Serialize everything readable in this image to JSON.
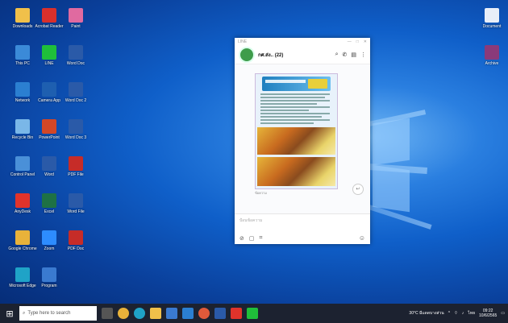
{
  "desktop": {
    "left_icons": [
      {
        "name": "folder-icon",
        "label": "Downloads",
        "color": "#f0c04a"
      },
      {
        "name": "pdf-icon",
        "label": "Acrobat Reader",
        "color": "#d9302c"
      },
      {
        "name": "paint-icon",
        "label": "Paint",
        "color": "#e06aa0"
      },
      {
        "name": "computer-icon",
        "label": "This PC",
        "color": "#3b8ad8"
      },
      {
        "name": "line-icon",
        "label": "LINE",
        "color": "#1fbf3a"
      },
      {
        "name": "word-icon",
        "label": "Word Doc",
        "color": "#2a5aa8"
      },
      {
        "name": "network-icon",
        "label": "Network",
        "color": "#2b7fd1"
      },
      {
        "name": "camera-icon",
        "label": "Camera App",
        "color": "#1e5fb0"
      },
      {
        "name": "word-icon",
        "label": "Word Doc 2",
        "color": "#2a5aa8"
      },
      {
        "name": "recycle-bin-icon",
        "label": "Recycle Bin",
        "color": "#7ab7e8"
      },
      {
        "name": "powerpoint-icon",
        "label": "PowerPoint",
        "color": "#d24726"
      },
      {
        "name": "word-icon",
        "label": "Word Doc 3",
        "color": "#2a5aa8"
      },
      {
        "name": "control-panel-icon",
        "label": "Control Panel",
        "color": "#4a90d8"
      },
      {
        "name": "word-icon",
        "label": "Word",
        "color": "#2a5aa8"
      },
      {
        "name": "pdf-icon",
        "label": "PDF File",
        "color": "#c62c28"
      },
      {
        "name": "anydesk-icon",
        "label": "AnyDesk",
        "color": "#e0332b"
      },
      {
        "name": "excel-icon",
        "label": "Excel",
        "color": "#1e7145"
      },
      {
        "name": "word-icon",
        "label": "Word File",
        "color": "#2a5aa8"
      },
      {
        "name": "chrome-icon",
        "label": "Google Chrome",
        "color": "#e8b23a"
      },
      {
        "name": "zoom-icon",
        "label": "Zoom",
        "color": "#2d8cff"
      },
      {
        "name": "pdf-icon",
        "label": "PDF Doc",
        "color": "#c62c28"
      },
      {
        "name": "edge-icon",
        "label": "Microsoft Edge",
        "color": "#1fa3c7"
      },
      {
        "name": "app-icon",
        "label": "Program",
        "color": "#3a7ad0"
      }
    ],
    "right_icons": [
      {
        "name": "file-icon",
        "label": "Document",
        "color": "#e8eef8"
      },
      {
        "name": "winrar-icon",
        "label": "Archive",
        "color": "#8a3a7a"
      }
    ]
  },
  "chat": {
    "window_title": "LINE",
    "name": "กศ.ส่ง.. (22)",
    "placeholder": "ป้อนข้อความ",
    "caption": "ข้อความ",
    "reply_count": "1"
  },
  "taskbar": {
    "search_placeholder": "Type here to search",
    "weather": "30°C  มีแดดบางส่วน",
    "lang": "ไทย",
    "time": "09:22",
    "date": "10/6/2565"
  }
}
